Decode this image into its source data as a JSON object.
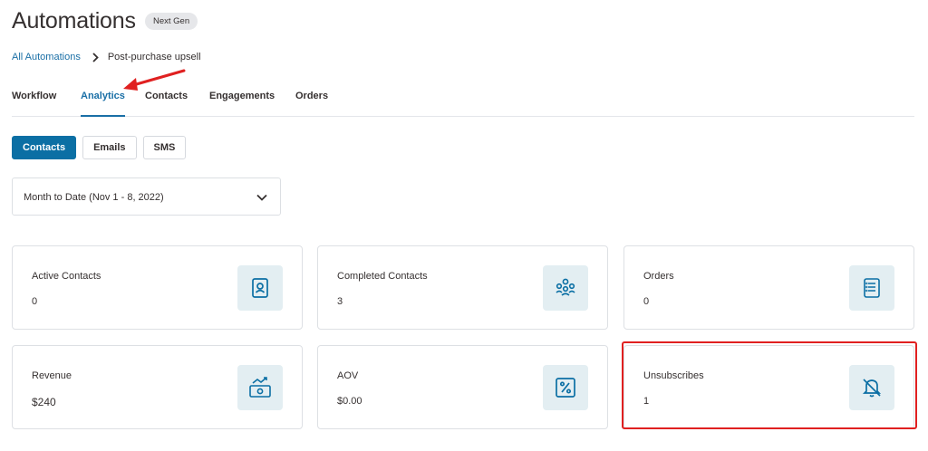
{
  "header": {
    "title": "Automations",
    "badge": "Next Gen"
  },
  "breadcrumb": {
    "parent": "All Automations",
    "current": "Post-purchase upsell"
  },
  "tabs": [
    {
      "label": "Workflow"
    },
    {
      "label": "Analytics",
      "active": true
    },
    {
      "label": "Contacts"
    },
    {
      "label": "Engagements"
    },
    {
      "label": "Orders"
    }
  ],
  "subtabs": [
    {
      "label": "Contacts",
      "active": true
    },
    {
      "label": "Emails"
    },
    {
      "label": "SMS"
    }
  ],
  "date_filter": {
    "value": "Month to Date (Nov 1 - 8, 2022)"
  },
  "cards": [
    {
      "label": "Active Contacts",
      "value": "0",
      "icon": "contact-book-icon"
    },
    {
      "label": "Completed Contacts",
      "value": "3",
      "icon": "group-icon"
    },
    {
      "label": "Orders",
      "value": "0",
      "icon": "receipt-icon"
    },
    {
      "label": "Revenue",
      "value": "$240",
      "icon": "revenue-icon"
    },
    {
      "label": "AOV",
      "value": "$0.00",
      "icon": "percent-icon"
    },
    {
      "label": "Unsubscribes",
      "value": "1",
      "icon": "bell-off-icon"
    }
  ],
  "colors": {
    "accent": "#1a6fa6",
    "primary_button": "#0b6fa4",
    "icon_tile": "#e3eef2",
    "annotation": "#e02020"
  }
}
